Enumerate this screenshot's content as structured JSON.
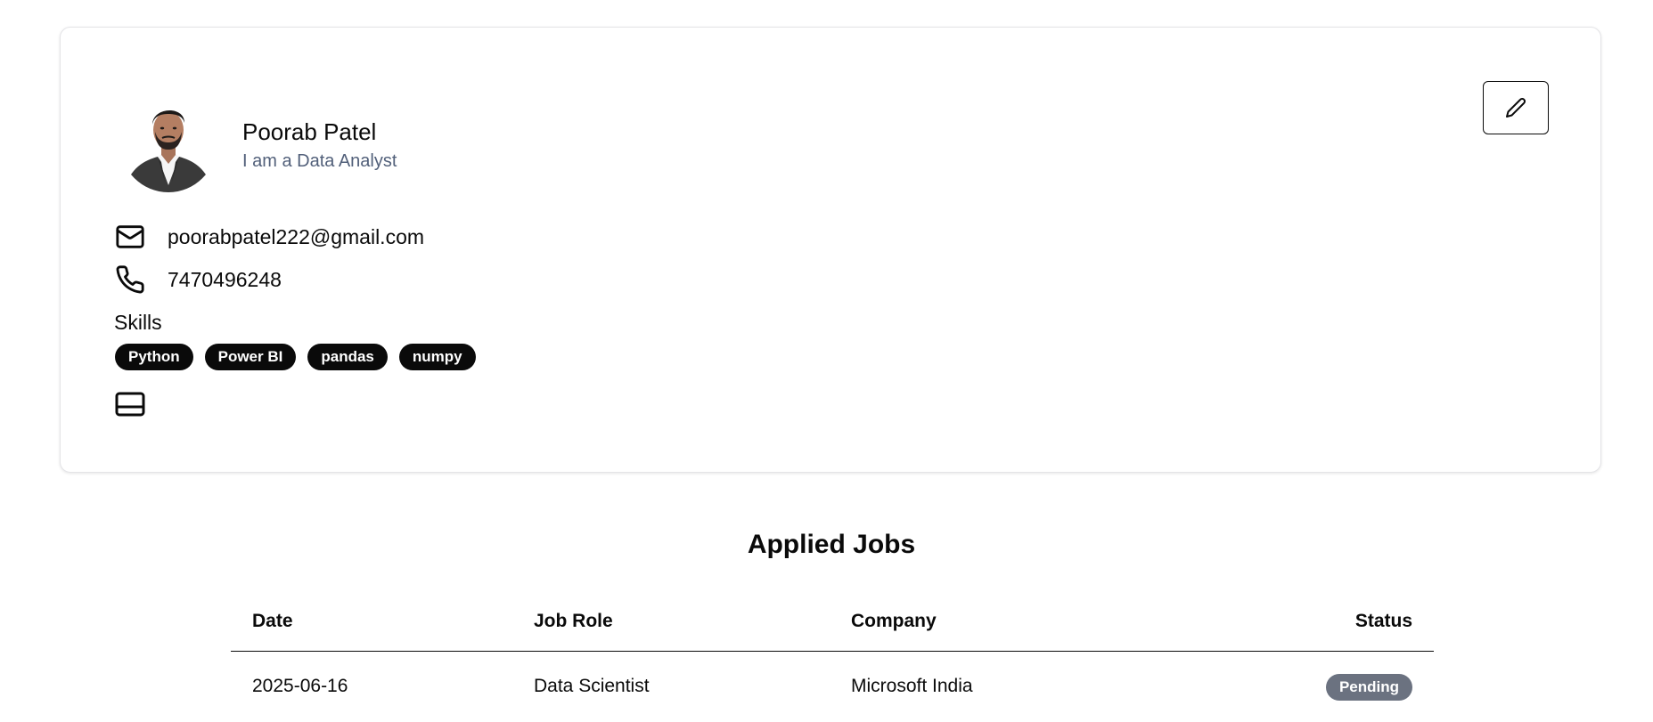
{
  "profile": {
    "name": "Poorab Patel",
    "bio": "I am a Data Analyst",
    "email": "poorabpatel222@gmail.com",
    "phone": "7470496248",
    "skills_label": "Skills",
    "skills": [
      "Python",
      "Power BI",
      "pandas",
      "numpy"
    ],
    "icons": {
      "edit": "pencil-icon",
      "email": "mail-icon",
      "phone": "phone-icon",
      "resume": "resume-card-icon"
    }
  },
  "applied_jobs": {
    "title": "Applied Jobs",
    "columns": [
      "Date",
      "Job Role",
      "Company",
      "Status"
    ],
    "rows": [
      {
        "date": "2025-06-16",
        "role": "Data Scientist",
        "company": "Microsoft India",
        "status": "Pending"
      }
    ]
  },
  "colors": {
    "text": "#0a0a0a",
    "muted": "#52607a",
    "badge_bg": "#0a0a0a",
    "status_pending_bg": "#6b7280",
    "card_border": "#e4e4e7"
  }
}
